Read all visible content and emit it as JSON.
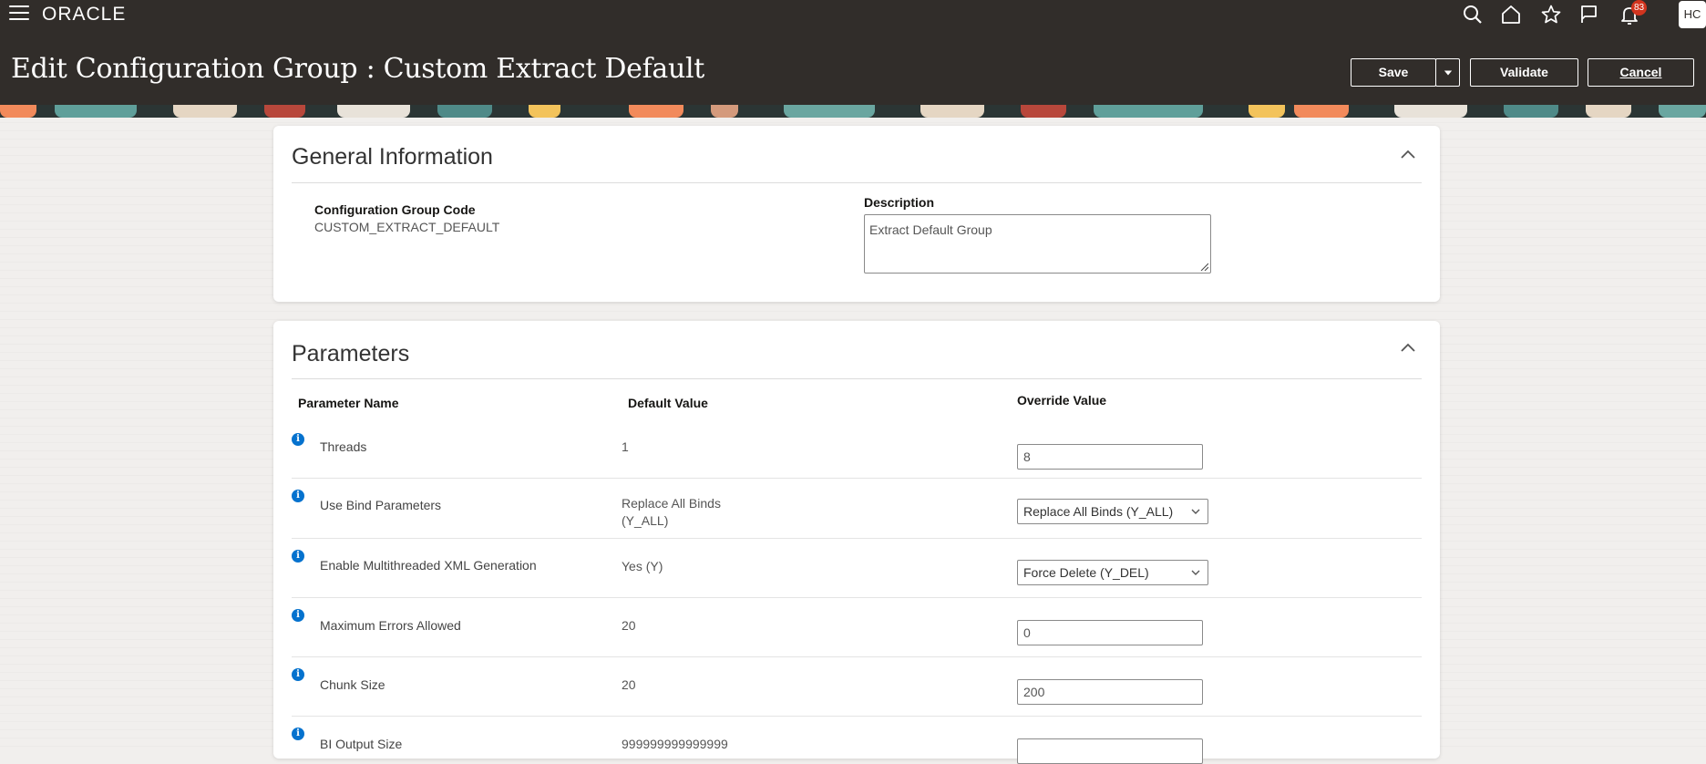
{
  "header": {
    "logo": "ORACLE",
    "title": "Edit Configuration Group : Custom Extract Default",
    "notification_count": "83",
    "avatar_initials": "HC",
    "buttons": {
      "save": "Save",
      "validate": "Validate",
      "cancel": "Cancel"
    },
    "icons": [
      "hamburger-icon",
      "search-icon",
      "home-icon",
      "star-icon",
      "flag-icon",
      "bell-icon"
    ]
  },
  "general": {
    "title": "General Information",
    "code_label": "Configuration Group Code",
    "code_value": "CUSTOM_EXTRACT_DEFAULT",
    "description_label": "Description",
    "description_value": "Extract Default Group"
  },
  "parameters": {
    "title": "Parameters",
    "columns": {
      "name": "Parameter Name",
      "default": "Default Value",
      "override": "Override Value"
    },
    "rows": [
      {
        "name": "Threads",
        "default": "1",
        "override": "8",
        "control": "input"
      },
      {
        "name": "Use Bind Parameters",
        "default": "Replace All Binds (Y_ALL)",
        "override": "Replace All Binds (Y_ALL)",
        "control": "select"
      },
      {
        "name": "Enable Multithreaded XML Generation",
        "default": "Yes (Y)",
        "override": "Force Delete (Y_DEL)",
        "control": "select"
      },
      {
        "name": "Maximum Errors Allowed",
        "default": "20",
        "override": "0",
        "control": "input"
      },
      {
        "name": "Chunk Size",
        "default": "20",
        "override": "200",
        "control": "input"
      },
      {
        "name": "BI Output Size",
        "default": "999999999999999",
        "override": "",
        "control": "input"
      }
    ]
  },
  "colors": {
    "header_bg": "#312d2a",
    "info_icon": "#0572ce",
    "badge": "#d1341e"
  }
}
